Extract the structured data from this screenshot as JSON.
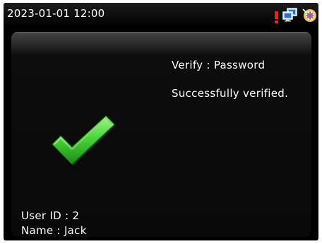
{
  "status_bar": {
    "datetime": "2023-01-01 12:00",
    "icons": [
      "alert-icon",
      "network-icon",
      "settings-icon"
    ],
    "colors": {
      "background": "#000000",
      "alert": "#ff1a1a"
    }
  },
  "result": {
    "verify_mode": "Verify : Password",
    "message": "Successfully verified.",
    "icon": "checkmark-icon",
    "icon_color": "#4ad63a"
  },
  "user": {
    "user_id": "User ID : 2",
    "name": "Name : Jack"
  }
}
